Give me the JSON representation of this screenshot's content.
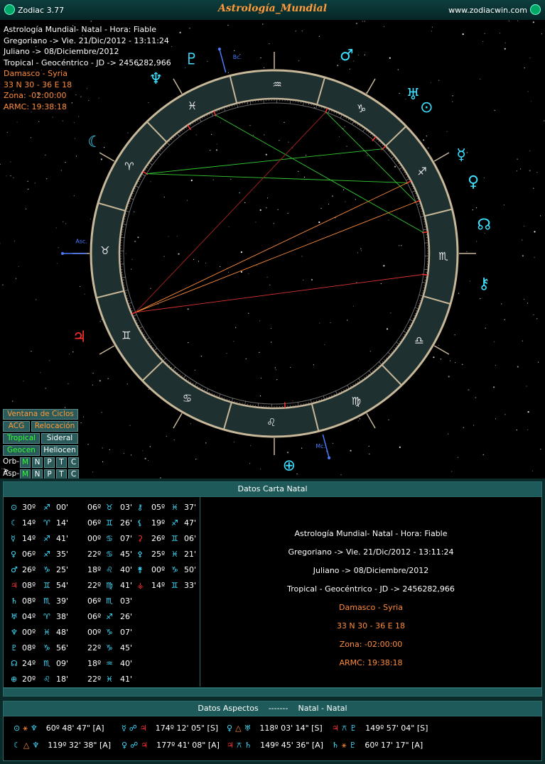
{
  "app": {
    "name": "Zodiac 3.77",
    "title": "Astrología_Mundial",
    "url": "www.zodiacwin.com"
  },
  "info": {
    "lines": [
      "Astrología Mundial- Natal - Hora: Fiable",
      "Gregoriano -> Vie. 21/Dic/2012 - 13:11:24",
      "Juliano -> 08/Diciembre/2012",
      "Tropical - Geocéntrico - JD -> 2456282,966"
    ],
    "orange_lines": [
      "Damasco - Syria",
      "33 N 30 - 36 E 18",
      "Zona: -02:00:00",
      "ARMC: 19:38:18"
    ]
  },
  "chart": {
    "asc_label": "Asc.",
    "mc_label": "Mc.",
    "bc_label": "Bc.",
    "signs": [
      "♈",
      "♉",
      "♊",
      "♋",
      "♌",
      "♍",
      "♎",
      "♏",
      "♐",
      "♑",
      "♒",
      "♓"
    ],
    "planet_glyphs": [
      {
        "glyph": "♂",
        "color": "#3fe0ff",
        "name": "mars"
      },
      {
        "glyph": "♅",
        "color": "#3fe0ff",
        "name": "uranus"
      },
      {
        "glyph": "⊙",
        "color": "#3fe0ff",
        "name": "sun"
      },
      {
        "glyph": "☿",
        "color": "#3fe0ff",
        "name": "mercury"
      },
      {
        "glyph": "♀",
        "color": "#3fe0ff",
        "name": "venus"
      },
      {
        "glyph": "☊",
        "color": "#3fe0ff",
        "name": "node"
      },
      {
        "glyph": "⚷",
        "color": "#3fe0ff",
        "name": "chiron"
      },
      {
        "glyph": "♃",
        "color": "#ff3030",
        "name": "jupiter"
      },
      {
        "glyph": "⊕",
        "color": "#3fe0ff",
        "name": "earth"
      },
      {
        "glyph": "☾",
        "color": "#3fe0ff",
        "name": "moon"
      },
      {
        "glyph": "♇",
        "color": "#3fe0ff",
        "name": "pluto"
      },
      {
        "glyph": "♆",
        "color": "#3fe0ff",
        "name": "neptune"
      }
    ]
  },
  "controls": {
    "ventana": "Ventana de Ciclos",
    "acg": "ACG",
    "relocacion": "Relocación",
    "tropical": "Tropical",
    "sideral": "Sideral",
    "geocen": "Geocen",
    "heliocen": "Heliocen",
    "orb_label": "Orb->",
    "asp_label": "Asp->",
    "toggles": [
      "M",
      "N",
      "P",
      "T",
      "C"
    ]
  },
  "natal": {
    "header": "Datos Carta Natal",
    "positions": [
      [
        "⊙",
        "30º",
        "♐",
        "00'",
        "06º",
        "♉",
        "03'",
        "⚷",
        "05º",
        "♓",
        "37'"
      ],
      [
        "☾",
        "14º",
        "♈",
        "14'",
        "06º",
        "♊",
        "26'",
        "⚸",
        "19º",
        "♐",
        "47'"
      ],
      [
        "☿",
        "14º",
        "♐",
        "41'",
        "00º",
        "♋",
        "07'",
        "⚳",
        "26º",
        "♊",
        "06'"
      ],
      [
        "♀",
        "06º",
        "♐",
        "35'",
        "22º",
        "♋",
        "45'",
        "⚴",
        "25º",
        "♓",
        "21'"
      ],
      [
        "♂",
        "26º",
        "♑",
        "25'",
        "18º",
        "♌",
        "40'",
        "⚵",
        "00º",
        "♑",
        "50'"
      ],
      [
        "♃",
        "08º",
        "♊",
        "54'",
        "22º",
        "♍",
        "41'",
        "⚶",
        "14º",
        "♊",
        "33'"
      ],
      [
        "♄",
        "08º",
        "♏",
        "39'",
        "06º",
        "♏",
        "03'",
        "",
        "",
        "",
        ""
      ],
      [
        "♅",
        "04º",
        "♈",
        "38'",
        "06º",
        "♐",
        "26'",
        "",
        "",
        "",
        ""
      ],
      [
        "♆",
        "00º",
        "♓",
        "48'",
        "00º",
        "♑",
        "07'",
        "",
        "",
        "",
        ""
      ],
      [
        "♇",
        "08º",
        "♑",
        "56'",
        "22º",
        "♑",
        "45'",
        "",
        "",
        "",
        ""
      ],
      [
        "☊",
        "24º",
        "♏",
        "09'",
        "18º",
        "♒",
        "40'",
        "",
        "",
        "",
        ""
      ],
      [
        "⊕",
        "20º",
        "♌",
        "18'",
        "22º",
        "♓",
        "41'",
        "",
        "",
        "",
        ""
      ]
    ],
    "center": [
      "Astrología Mundial- Natal - Hora: Fiable",
      "Gregoriano -> Vie. 21/Dic/2012 - 13:11:24",
      "Juliano -> 08/Diciembre/2012",
      "Tropical - Geocéntrico - JD -> 2456282,966"
    ],
    "center_orange": [
      "Damasco - Syria",
      "33 N 30 - 36 E 18",
      "Zona: -02:00:00",
      "ARMC: 19:38:18"
    ]
  },
  "aspects": {
    "header_left": "Datos Aspectos",
    "header_sep": "-------",
    "header_right": "Natal - Natal",
    "rows": [
      [
        {
          "g1": "⊙",
          "a": "⚹",
          "g2": "♆",
          "val": "60º 48' 47\" [A]"
        },
        {
          "g1": "☿",
          "a": "☍",
          "g2": "♃",
          "val": "174º 12' 05\" [S]"
        },
        {
          "g1": "♀",
          "a": "△",
          "g2": "♅",
          "val": "118º 03' 14\" [S]"
        },
        {
          "g1": "♃",
          "a": "⚻",
          "g2": "♇",
          "val": "149º 57' 04\" [S]"
        }
      ],
      [
        {
          "g1": "☾",
          "a": "△",
          "g2": "♆",
          "val": "119º 32' 38\" [A]"
        },
        {
          "g1": "♀",
          "a": "☍",
          "g2": "♃",
          "val": "177º 41' 08\" [A]"
        },
        {
          "g1": "♃",
          "a": "⚻",
          "g2": "♄",
          "val": "149º 45' 36\" [A]"
        },
        {
          "g1": "♄",
          "a": "⚹",
          "g2": "♇",
          "val": "60º 17' 17\" [A]"
        }
      ]
    ]
  },
  "colors": {
    "orange": "#ff8c3a",
    "cyan": "#3fe0ff",
    "red": "#ff3030",
    "panel": "#1e5a5a"
  }
}
